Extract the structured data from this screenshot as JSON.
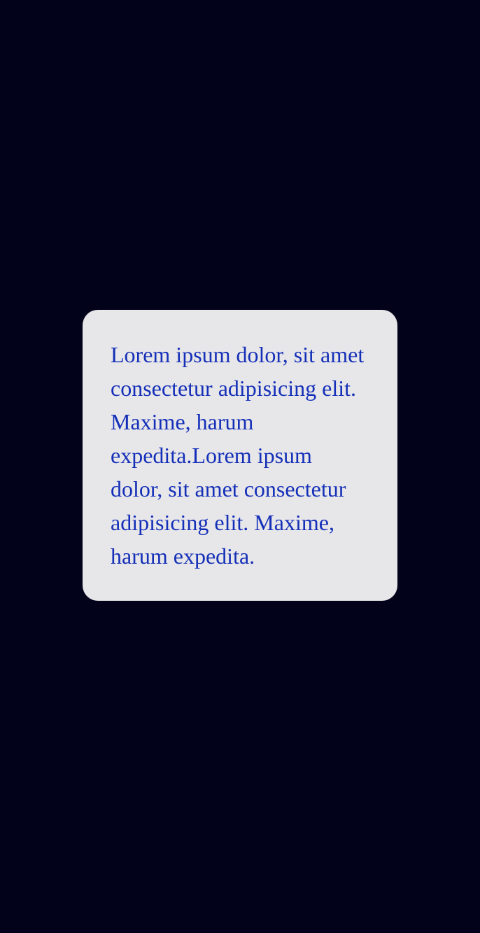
{
  "card": {
    "text": "Lorem ipsum dolor, sit amet consectetur adipisicing elit. Maxime, harum expedita.Lorem ipsum dolor, sit amet consectetur adipisicing elit. Maxime, harum expedita."
  },
  "colors": {
    "background": "#02031a",
    "card_background": "#e7e6e9",
    "text": "#1530b8"
  }
}
